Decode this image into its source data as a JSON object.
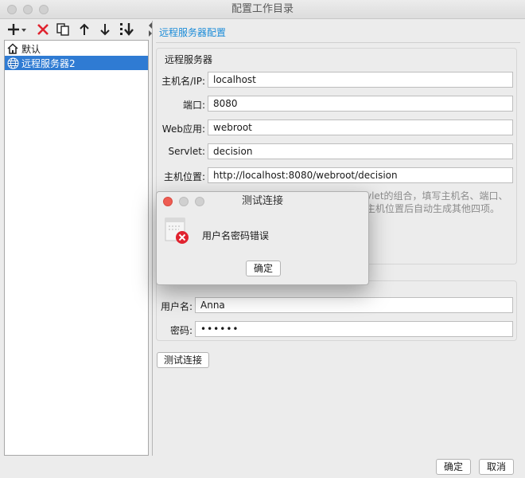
{
  "window": {
    "title": "配置工作目录"
  },
  "toolbar": {
    "icons": [
      "plus-dropdown-icon",
      "delete-x-icon",
      "copy-icon",
      "move-up-icon",
      "move-down-icon",
      "sort-icon"
    ]
  },
  "tree": {
    "items": [
      {
        "label": "默认",
        "icon": "home-icon",
        "selected": false
      },
      {
        "label": "远程服务器2",
        "icon": "globe-icon",
        "selected": true
      }
    ]
  },
  "panel": {
    "title": "远程服务器配置",
    "server_group": {
      "title": "远程服务器",
      "host_label": "主机名/IP:",
      "host_value": "localhost",
      "port_label": "端口:",
      "port_value": "8080",
      "webapp_label": "Web应用:",
      "webapp_value": "webroot",
      "servlet_label": "Servlet:",
      "servlet_value": "decision",
      "location_label": "主机位置:",
      "location_value": "http://localhost:8080/webroot/decision",
      "hint_line1": "vlet的组合，填写主机名、端口、",
      "hint_line2": "主机位置后自动生成其他四项。"
    },
    "auth_group": {
      "username_label": "用户名:",
      "username_value": "Anna",
      "password_label": "密码:",
      "password_value": "••••••"
    },
    "test_button": "测试连接"
  },
  "footer": {
    "ok": "确定",
    "cancel": "取消"
  },
  "dialog": {
    "title": "测试连接",
    "message": "用户名密码错误",
    "ok": "确定",
    "close_color": "#ee5c52"
  },
  "colors": {
    "accent": "#1a8bd8",
    "selection": "#2f7bd3",
    "error": "#e0232f"
  }
}
